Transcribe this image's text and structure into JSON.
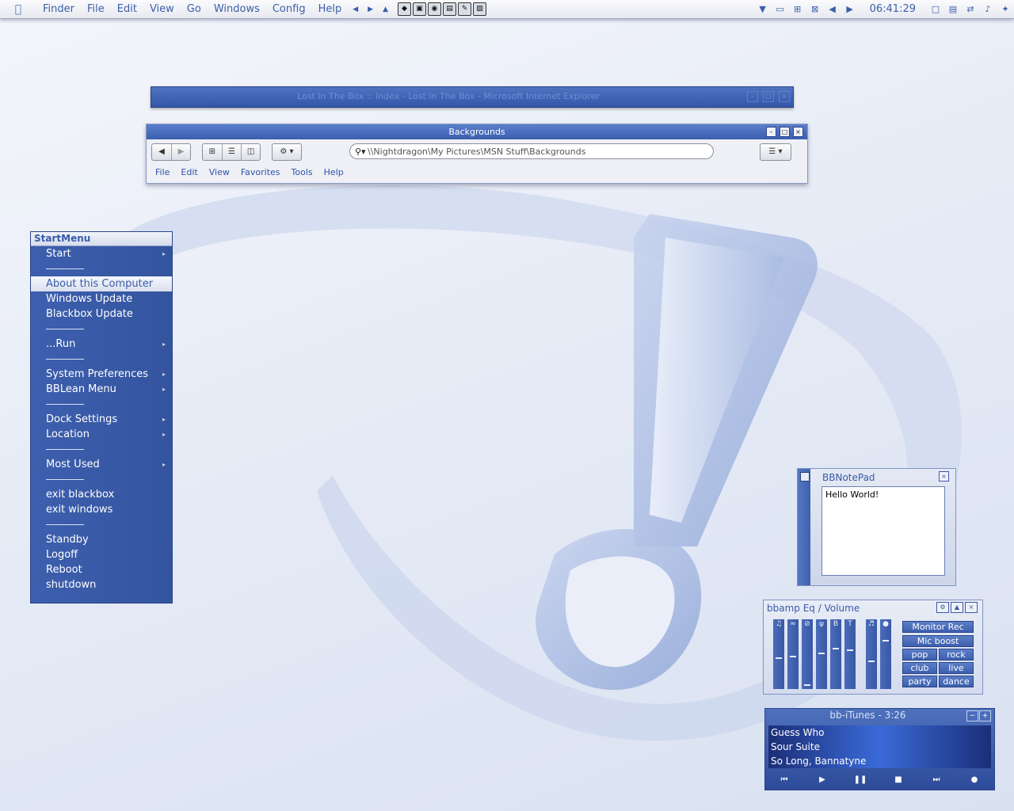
{
  "menubar": {
    "apple_icon": "apple-icon",
    "items": [
      "Finder",
      "File",
      "Edit",
      "View",
      "Go",
      "Windows",
      "Config",
      "Help"
    ],
    "clock": "06:41:29"
  },
  "ie_window": {
    "title": "Lost In The Box :: Index - Lost In The Box - Microsoft Internet Explorer"
  },
  "explorer": {
    "title": "Backgrounds",
    "address": "\\\\Nightdragon\\My Pictures\\MSN Stuff\\Backgrounds",
    "menu": [
      "File",
      "Edit",
      "View",
      "Favorites",
      "Tools",
      "Help"
    ]
  },
  "start_menu": {
    "title": "StartMenu",
    "items": [
      {
        "label": "Start",
        "sub": true
      },
      {
        "sep": true
      },
      {
        "label": "About this Computer",
        "selected": true
      },
      {
        "label": "Windows Update"
      },
      {
        "label": "Blackbox Update"
      },
      {
        "sep": true
      },
      {
        "label": "...Run",
        "sub": true
      },
      {
        "sep": true
      },
      {
        "label": "System Preferences",
        "sub": true
      },
      {
        "label": "BBLean Menu",
        "sub": true
      },
      {
        "sep": true
      },
      {
        "label": "Dock Settings",
        "sub": true
      },
      {
        "label": "Location",
        "sub": true
      },
      {
        "sep": true
      },
      {
        "label": "Most Used",
        "sub": true
      },
      {
        "sep": true
      },
      {
        "label": "exit blackbox"
      },
      {
        "label": "exit windows"
      },
      {
        "sep": true
      },
      {
        "label": "Standby"
      },
      {
        "label": "Logoff"
      },
      {
        "label": "Reboot"
      },
      {
        "label": "shutdown"
      }
    ]
  },
  "notepad": {
    "title": "BBNotePad",
    "text": "Hello World!"
  },
  "eq": {
    "title": "bbamp Eq / Volume",
    "slider_labels": [
      "B",
      "T"
    ],
    "buttons": [
      "Monitor Rec",
      "Mic boost",
      "pop",
      "rock",
      "club",
      "live",
      "party",
      "dance"
    ]
  },
  "itunes": {
    "title": "bb-iTunes - 3:26",
    "tracks": [
      "Guess Who",
      "Sour Suite",
      "So Long, Bannatyne"
    ]
  }
}
